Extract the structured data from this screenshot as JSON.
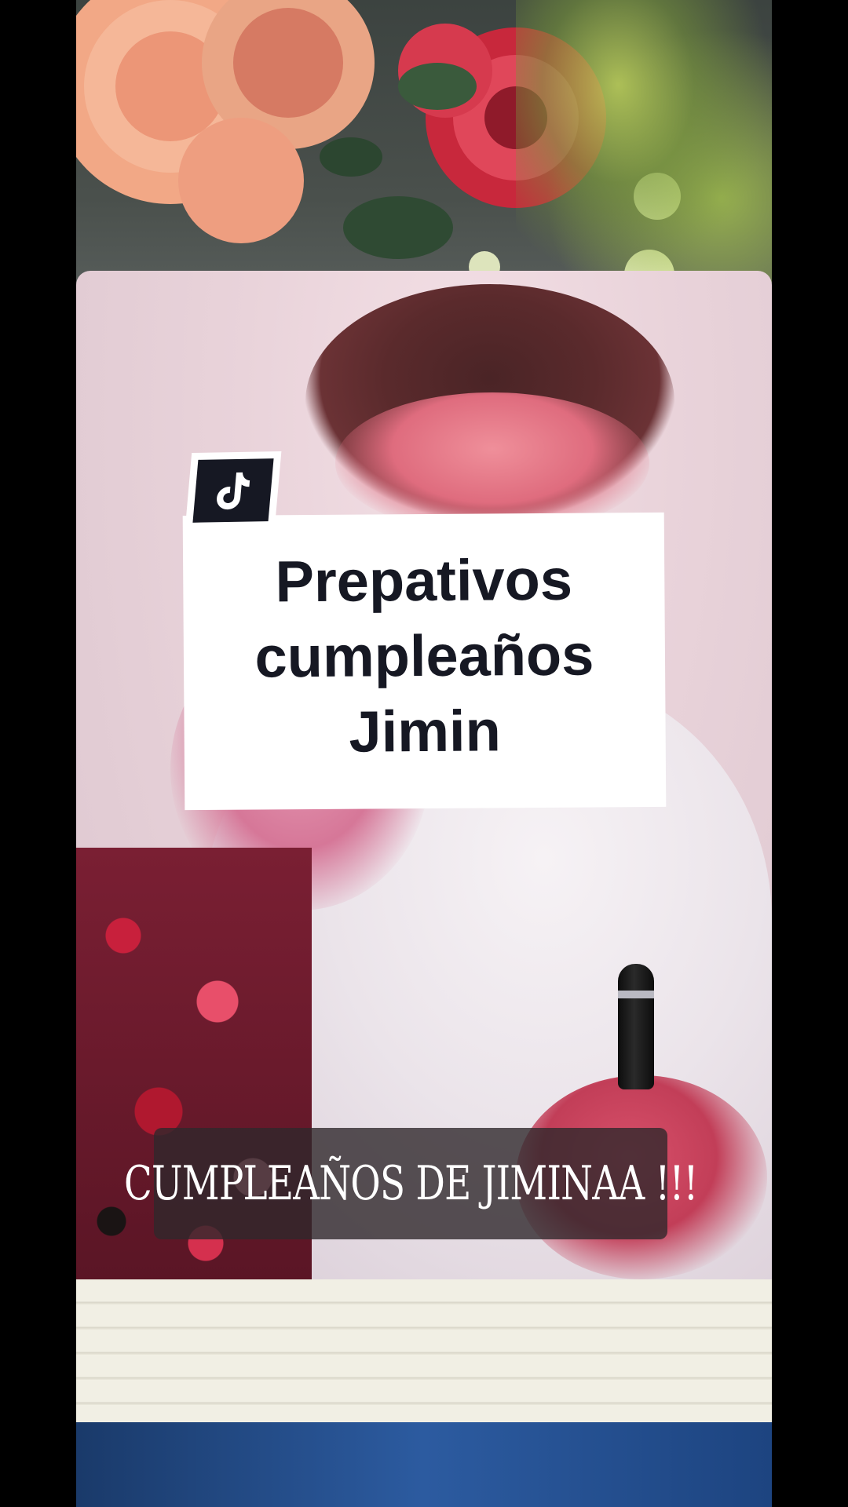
{
  "video": {
    "overlay_title_lines": [
      "Prepativos",
      "cumpleaños",
      "Jimin"
    ],
    "caption": "CUMPLEAÑOS DE JIMINAA !!!",
    "badge_icon": "tiktok-logo-icon"
  },
  "colors": {
    "title_card_bg": "#ffffff",
    "title_text": "#161823",
    "badge_bg": "#161823",
    "caption_bg": "#30282c",
    "caption_text": "#ffffff",
    "letterbox": "#000000"
  }
}
